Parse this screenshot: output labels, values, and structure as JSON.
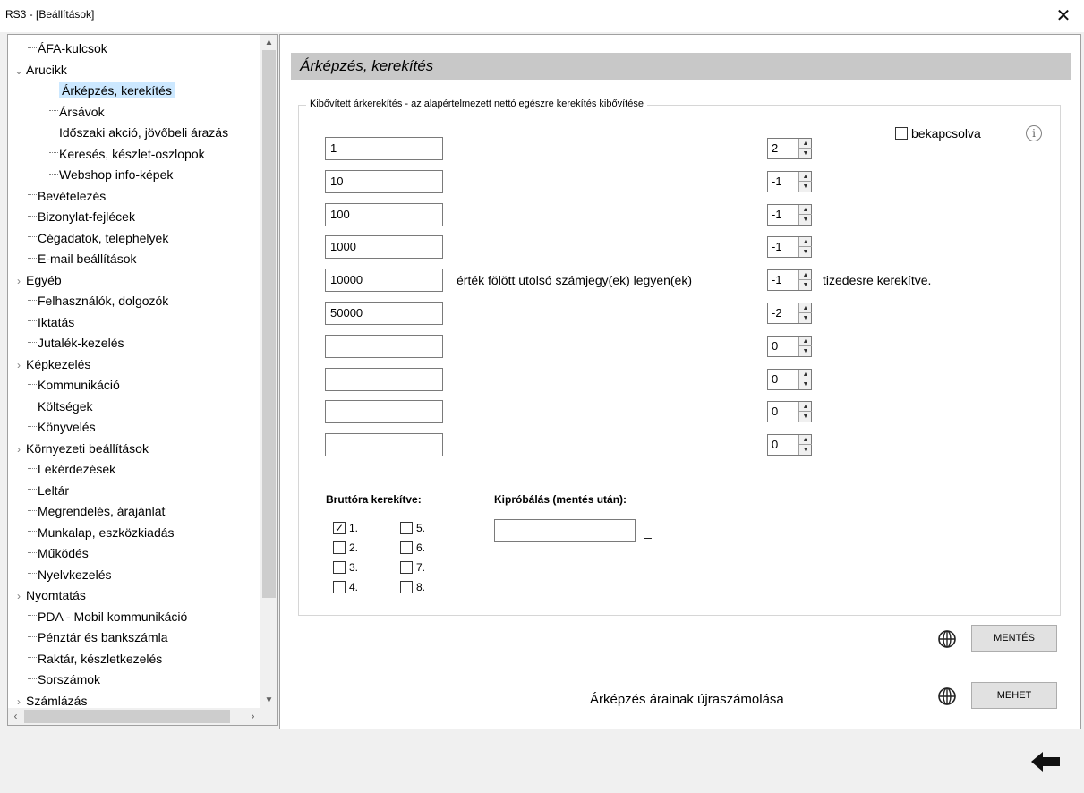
{
  "window": {
    "title": "RS3 - [Beállítások]",
    "close_glyph": "✕"
  },
  "tree": {
    "items": [
      {
        "label": "ÁFA-kulcsok",
        "level": 0,
        "expander": ""
      },
      {
        "label": "Árucikk",
        "level": 0,
        "expander": "expanded"
      },
      {
        "label": "Árképzés, kerekítés",
        "level": 1,
        "expander": "",
        "selected": true
      },
      {
        "label": "Ársávok",
        "level": 1,
        "expander": ""
      },
      {
        "label": "Időszaki akció, jövőbeli árazás",
        "level": 1,
        "expander": ""
      },
      {
        "label": "Keresés, készlet-oszlopok",
        "level": 1,
        "expander": ""
      },
      {
        "label": "Webshop info-képek",
        "level": 1,
        "expander": ""
      },
      {
        "label": "Bevételezés",
        "level": 0,
        "expander": ""
      },
      {
        "label": "Bizonylat-fejlécek",
        "level": 0,
        "expander": ""
      },
      {
        "label": "Cégadatok, telephelyek",
        "level": 0,
        "expander": ""
      },
      {
        "label": "E-mail beállítások",
        "level": 0,
        "expander": ""
      },
      {
        "label": "Egyéb",
        "level": 0,
        "expander": "collapsed"
      },
      {
        "label": "Felhasználók, dolgozók",
        "level": 0,
        "expander": ""
      },
      {
        "label": "Iktatás",
        "level": 0,
        "expander": ""
      },
      {
        "label": "Jutalék-kezelés",
        "level": 0,
        "expander": ""
      },
      {
        "label": "Képkezelés",
        "level": 0,
        "expander": "collapsed"
      },
      {
        "label": "Kommunikáció",
        "level": 0,
        "expander": ""
      },
      {
        "label": "Költségek",
        "level": 0,
        "expander": ""
      },
      {
        "label": "Könyvelés",
        "level": 0,
        "expander": ""
      },
      {
        "label": "Környezeti beállítások",
        "level": 0,
        "expander": "collapsed"
      },
      {
        "label": "Lekérdezések",
        "level": 0,
        "expander": ""
      },
      {
        "label": "Leltár",
        "level": 0,
        "expander": ""
      },
      {
        "label": "Megrendelés, árajánlat",
        "level": 0,
        "expander": ""
      },
      {
        "label": "Munkalap, eszközkiadás",
        "level": 0,
        "expander": ""
      },
      {
        "label": "Működés",
        "level": 0,
        "expander": ""
      },
      {
        "label": "Nyelvkezelés",
        "level": 0,
        "expander": ""
      },
      {
        "label": "Nyomtatás",
        "level": 0,
        "expander": "collapsed"
      },
      {
        "label": "PDA - Mobil kommunikáció",
        "level": 0,
        "expander": ""
      },
      {
        "label": "Pénztár és bankszámla",
        "level": 0,
        "expander": ""
      },
      {
        "label": "Raktár, készletkezelés",
        "level": 0,
        "expander": ""
      },
      {
        "label": "Sorszámok",
        "level": 0,
        "expander": ""
      },
      {
        "label": "Számlázás",
        "level": 0,
        "expander": "collapsed"
      }
    ]
  },
  "main": {
    "header": "Árképzés, kerekítés",
    "group_legend": "Kibővített árkerekítés  -  az alapértelmezett nettó egészre kerekítés kibővítése",
    "enabled_checkbox": {
      "label": "bekapcsolva",
      "checked": false
    },
    "rows": [
      {
        "threshold": "1",
        "decimals": "2"
      },
      {
        "threshold": "10",
        "decimals": "-1"
      },
      {
        "threshold": "100",
        "decimals": "-1"
      },
      {
        "threshold": "1000",
        "decimals": "-1"
      },
      {
        "threshold": "10000",
        "decimals": "-1"
      },
      {
        "threshold": "50000",
        "decimals": "-2"
      },
      {
        "threshold": "",
        "decimals": "0"
      },
      {
        "threshold": "",
        "decimals": "0"
      },
      {
        "threshold": "",
        "decimals": "0"
      },
      {
        "threshold": "",
        "decimals": "0"
      }
    ],
    "middle_text": "érték fölött utolsó számjegy(ek) legyen(ek)",
    "suffix_text": "tizedesre kerekítve.",
    "brutto": {
      "label": "Bruttóra kerekítve:",
      "options": [
        {
          "label": "1.",
          "checked": true
        },
        {
          "label": "2.",
          "checked": false
        },
        {
          "label": "3.",
          "checked": false
        },
        {
          "label": "4.",
          "checked": false
        },
        {
          "label": "5.",
          "checked": false
        },
        {
          "label": "6.",
          "checked": false
        },
        {
          "label": "7.",
          "checked": false
        },
        {
          "label": "8.",
          "checked": false
        }
      ]
    },
    "try": {
      "label": "Kipróbálás (mentés után):",
      "input_value": "",
      "result": "_"
    },
    "save_button": "MENTÉS",
    "recalc_label": "Árképzés árainak újraszámolása",
    "go_button": "MEHET"
  }
}
